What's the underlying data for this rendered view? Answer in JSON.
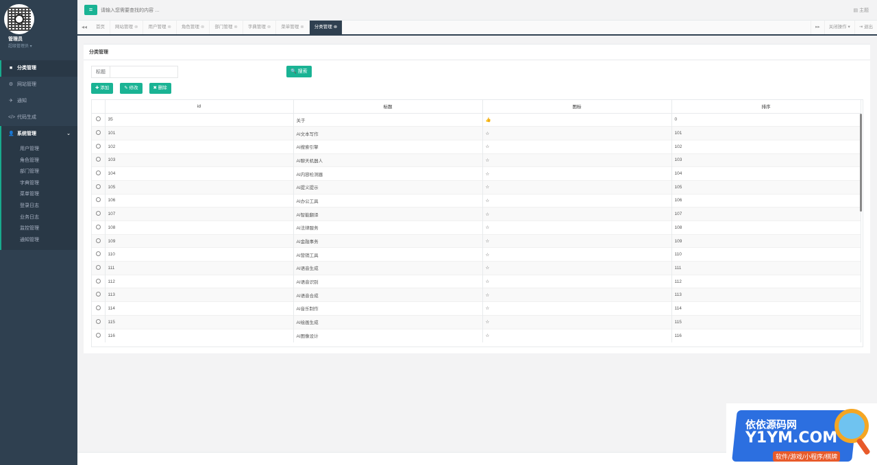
{
  "profile": {
    "name": "管理员",
    "role": "超级管理员 ▾"
  },
  "nav": [
    {
      "icon": "■",
      "label": "分类管理",
      "active": true
    },
    {
      "icon": "⚙",
      "label": "网站管理"
    },
    {
      "icon": "✈",
      "label": "通知"
    },
    {
      "icon": "</>",
      "label": "代码生成"
    }
  ],
  "system_menu": {
    "icon": "👤",
    "label": "系统管理",
    "arrow": "⌄",
    "items": [
      "用户管理",
      "角色管理",
      "部门管理",
      "字典管理",
      "菜单管理",
      "登录日志",
      "业务日志",
      "监控管理",
      "通知管理"
    ]
  },
  "topbar": {
    "menu_icon": "≡",
    "search_placeholder": "请输入您需要查找的内容 …",
    "theme": "▤ 主题"
  },
  "tabs": {
    "back": "◂◂",
    "items": [
      "首页",
      "网站管理",
      "用户管理",
      "角色管理",
      "部门管理",
      "字典管理",
      "菜单管理",
      "分类管理"
    ],
    "close_glyph": "⊗",
    "forward": "▸▸",
    "close_ops": "关闭操作 ▾",
    "logout": "⇥ 退出"
  },
  "panel": {
    "title": "分类管理",
    "filter_label": "标题",
    "search_btn": "🔍 搜索",
    "add_btn": "✚ 添加",
    "edit_btn": "✎ 修改",
    "delete_btn": "✖ 删除"
  },
  "table": {
    "columns": [
      "",
      "id",
      "标题",
      "图标",
      "排序"
    ],
    "rows": [
      [
        "35",
        "关于",
        "👍",
        "0"
      ],
      [
        "101",
        "AI文本写作",
        "☆",
        "101"
      ],
      [
        "102",
        "AI搜索引擎",
        "☆",
        "102"
      ],
      [
        "103",
        "AI聊天机器人",
        "☆",
        "103"
      ],
      [
        "104",
        "AI内容检测器",
        "☆",
        "104"
      ],
      [
        "105",
        "AI提义提示",
        "☆",
        "105"
      ],
      [
        "106",
        "AI办公工具",
        "☆",
        "106"
      ],
      [
        "107",
        "AI智能翻译",
        "☆",
        "107"
      ],
      [
        "108",
        "AI法律服务",
        "☆",
        "108"
      ],
      [
        "109",
        "AI金融事务",
        "☆",
        "109"
      ],
      [
        "110",
        "AI营销工具",
        "☆",
        "110"
      ],
      [
        "111",
        "AI语音生成",
        "☆",
        "111"
      ],
      [
        "112",
        "AI语音识别",
        "☆",
        "112"
      ],
      [
        "113",
        "AI语音合成",
        "☆",
        "113"
      ],
      [
        "114",
        "AI音乐制作",
        "☆",
        "114"
      ],
      [
        "115",
        "AI绘画生成",
        "☆",
        "115"
      ],
      [
        "116",
        "AI图像设计",
        "☆",
        "116"
      ]
    ]
  },
  "watermark": {
    "line1": "依依源码网",
    "line2": "Y1YM.COM",
    "line3": "软件/游戏/小程序/棋牌"
  }
}
